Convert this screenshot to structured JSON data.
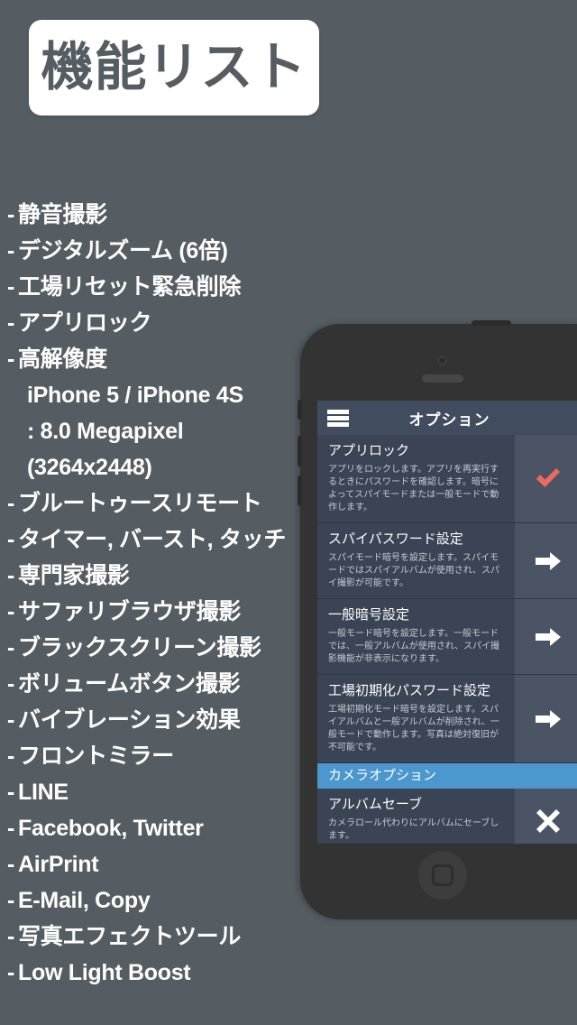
{
  "title": {
    "text": "機能リスト"
  },
  "features": [
    {
      "dash": "-",
      "text": "静音撮影",
      "indent": false
    },
    {
      "dash": "-",
      "text": "デジタルズーム (6倍)",
      "indent": false
    },
    {
      "dash": "-",
      "text": "工場リセット緊急削除",
      "indent": false
    },
    {
      "dash": "-",
      "text": "アプリロック",
      "indent": false
    },
    {
      "dash": "-",
      "text": "高解像度",
      "indent": false
    },
    {
      "dash": "",
      "text": "iPhone 5 / iPhone 4S",
      "indent": true
    },
    {
      "dash": "",
      "text": ": 8.0 Megapixel",
      "indent": true
    },
    {
      "dash": "",
      "text": "  (3264x2448)",
      "indent": true
    },
    {
      "dash": "-",
      "text": "ブルートゥースリモート",
      "indent": false
    },
    {
      "dash": "-",
      "text": "タイマー, バースト, タッチ",
      "indent": false
    },
    {
      "dash": "-",
      "text": "専門家撮影",
      "indent": false
    },
    {
      "dash": "-",
      "text": "サファリブラウザ撮影",
      "indent": false
    },
    {
      "dash": "-",
      "text": "ブラックスクリーン撮影",
      "indent": false
    },
    {
      "dash": "-",
      "text": "ボリュームボタン撮影",
      "indent": false
    },
    {
      "dash": "-",
      "text": "バイブレーション効果",
      "indent": false
    },
    {
      "dash": "-",
      "text": "フロントミラー",
      "indent": false
    },
    {
      "dash": "-",
      "text": "LINE",
      "indent": false
    },
    {
      "dash": "-",
      "text": "Facebook, Twitter",
      "indent": false
    },
    {
      "dash": "-",
      "text": "AirPrint",
      "indent": false
    },
    {
      "dash": "-",
      "text": "E-Mail, Copy",
      "indent": false
    },
    {
      "dash": "-",
      "text": "写真エフェクトツール",
      "indent": false
    },
    {
      "dash": "-",
      "text": "Low Light Boost",
      "indent": false
    }
  ],
  "phone": {
    "app": {
      "header": {
        "title": "オプション",
        "menu_icon": "hamburger-menu-icon"
      },
      "rows": [
        {
          "title": "アプリロック",
          "desc": "アプリをロックします。アプリを再実行するときにパスワードを確認します。暗号によってスパイモードまたは一般モードで動作します。",
          "action_icon": "check-icon",
          "action_color": "#ec6a5e"
        },
        {
          "title": "スパイパスワード設定",
          "desc": "スパイモード暗号を設定します。スパイモードではスパイアルバムが使用され、スパイ撮影が可能です。",
          "action_icon": "arrow-right-icon",
          "action_color": "#ffffff"
        },
        {
          "title": "一般暗号設定",
          "desc": "一般モード暗号を設定します。一般モードでは、一般アルバムが使用され、スパイ撮影機能が非表示になります。",
          "action_icon": "arrow-right-icon",
          "action_color": "#ffffff"
        },
        {
          "title": "工場初期化パスワード設定",
          "desc": "工場初期化モード暗号を設定します。スパイアルバムと一般アルバムが削除され、一般モードで動作します。写真は絶対復旧が不可能です。",
          "action_icon": "arrow-right-icon",
          "action_color": "#ffffff"
        }
      ],
      "section_header": "カメラオプション",
      "rows2": [
        {
          "title": "アルバムセーブ",
          "desc": "カメラロール代わりにアルバムにセーブします。",
          "action_icon": "cross-icon",
          "action_color": "#ffffff"
        }
      ]
    },
    "hardware": {
      "front_camera": "front-camera-icon",
      "earpiece": "earpiece-speaker",
      "home_button": "home-button"
    }
  },
  "colors": {
    "page_background": "#555d63",
    "title_plate": "#ffffff",
    "title_text": "#555d63",
    "screen_background": "#2f3640",
    "row_background": "#3a4454",
    "action_panel": "#4a5464",
    "section_blue": "#4d97cf",
    "check_red": "#ec6a5e",
    "phone_body": "#333333"
  }
}
